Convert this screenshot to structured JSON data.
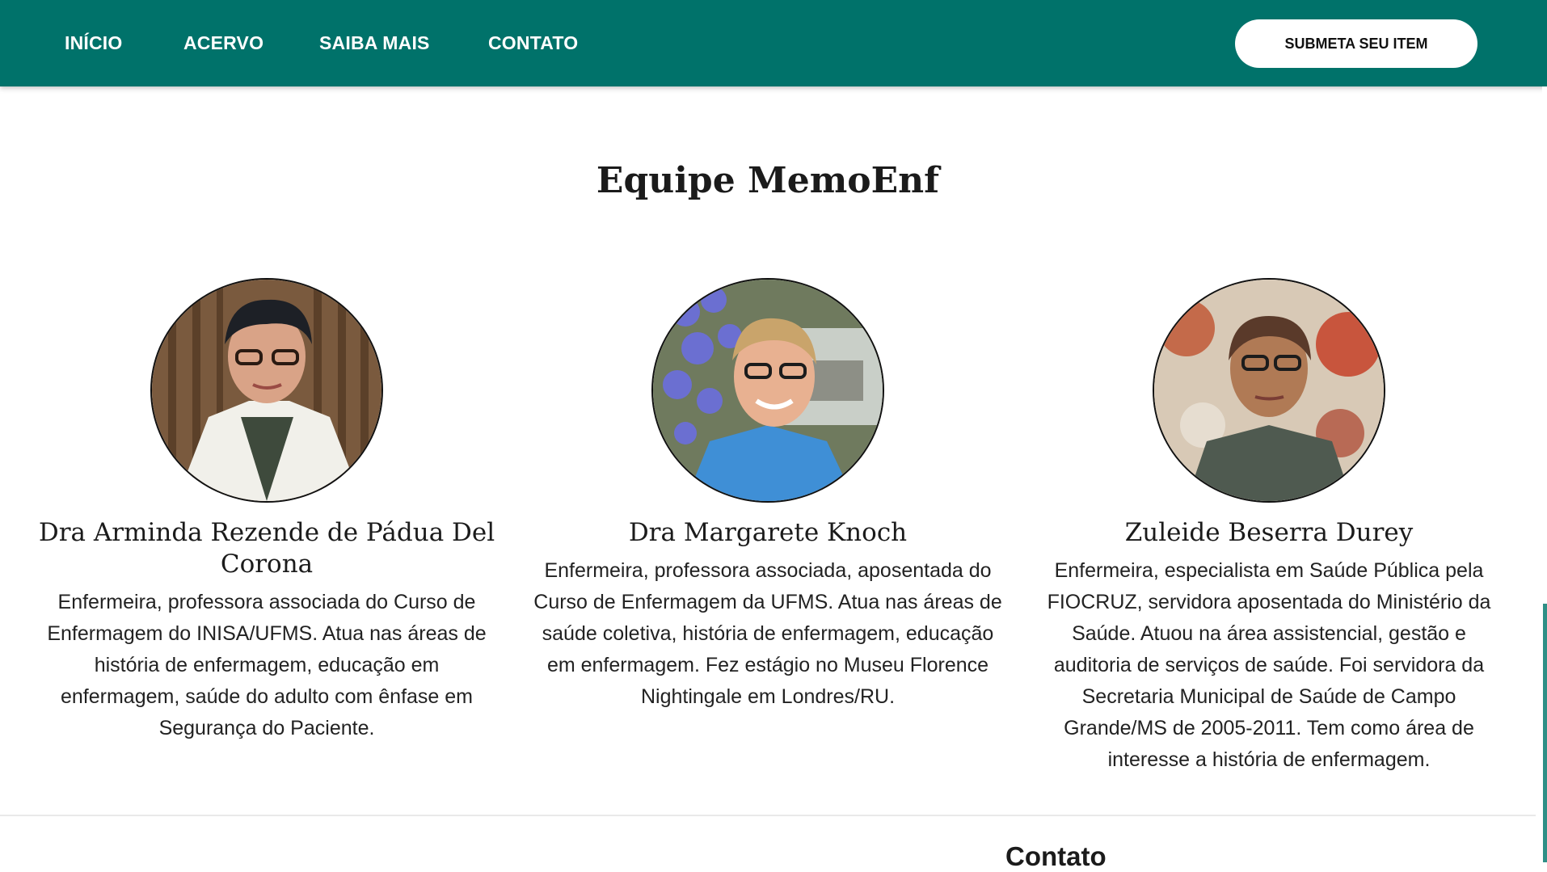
{
  "nav": {
    "links": [
      "INÍCIO",
      "ACERVO",
      "SAIBA MAIS",
      "CONTATO"
    ],
    "submit_label": "SUBMETA SEU ITEM"
  },
  "team": {
    "title": "Equipe MemoEnf",
    "members": [
      {
        "name": "Dra Arminda Rezende de Pádua Del Corona",
        "bio": "Enfermeira, professora associada do Curso de Enfermagem do INISA/UFMS. Atua nas áreas de história de enfermagem, educação em enfermagem, saúde do adulto com ênfase em Segurança do Paciente."
      },
      {
        "name": "Dra Margarete Knoch",
        "bio": "Enfermeira, professora associada, aposentada do Curso de Enfermagem da UFMS. Atua nas áreas de saúde coletiva, história de enfermagem, educação em enfermagem. Fez estágio no Museu Florence Nightingale em Londres/RU."
      },
      {
        "name": "Zuleide Beserra Durey",
        "bio": "Enfermeira, especialista em Saúde Pública pela FIOCRUZ, servidora aposentada do Ministério da Saúde. Atuou na área assistencial, gestão e auditoria de serviços de saúde. Foi servidora da Secretaria Municipal de Saúde de Campo Grande/MS de 2005-2011. Tem como área de interesse a história de enfermagem."
      }
    ]
  },
  "footer": {
    "contact_heading": "Contato"
  },
  "colors": {
    "brand": "#00726a",
    "accent": "#2f8f86"
  }
}
